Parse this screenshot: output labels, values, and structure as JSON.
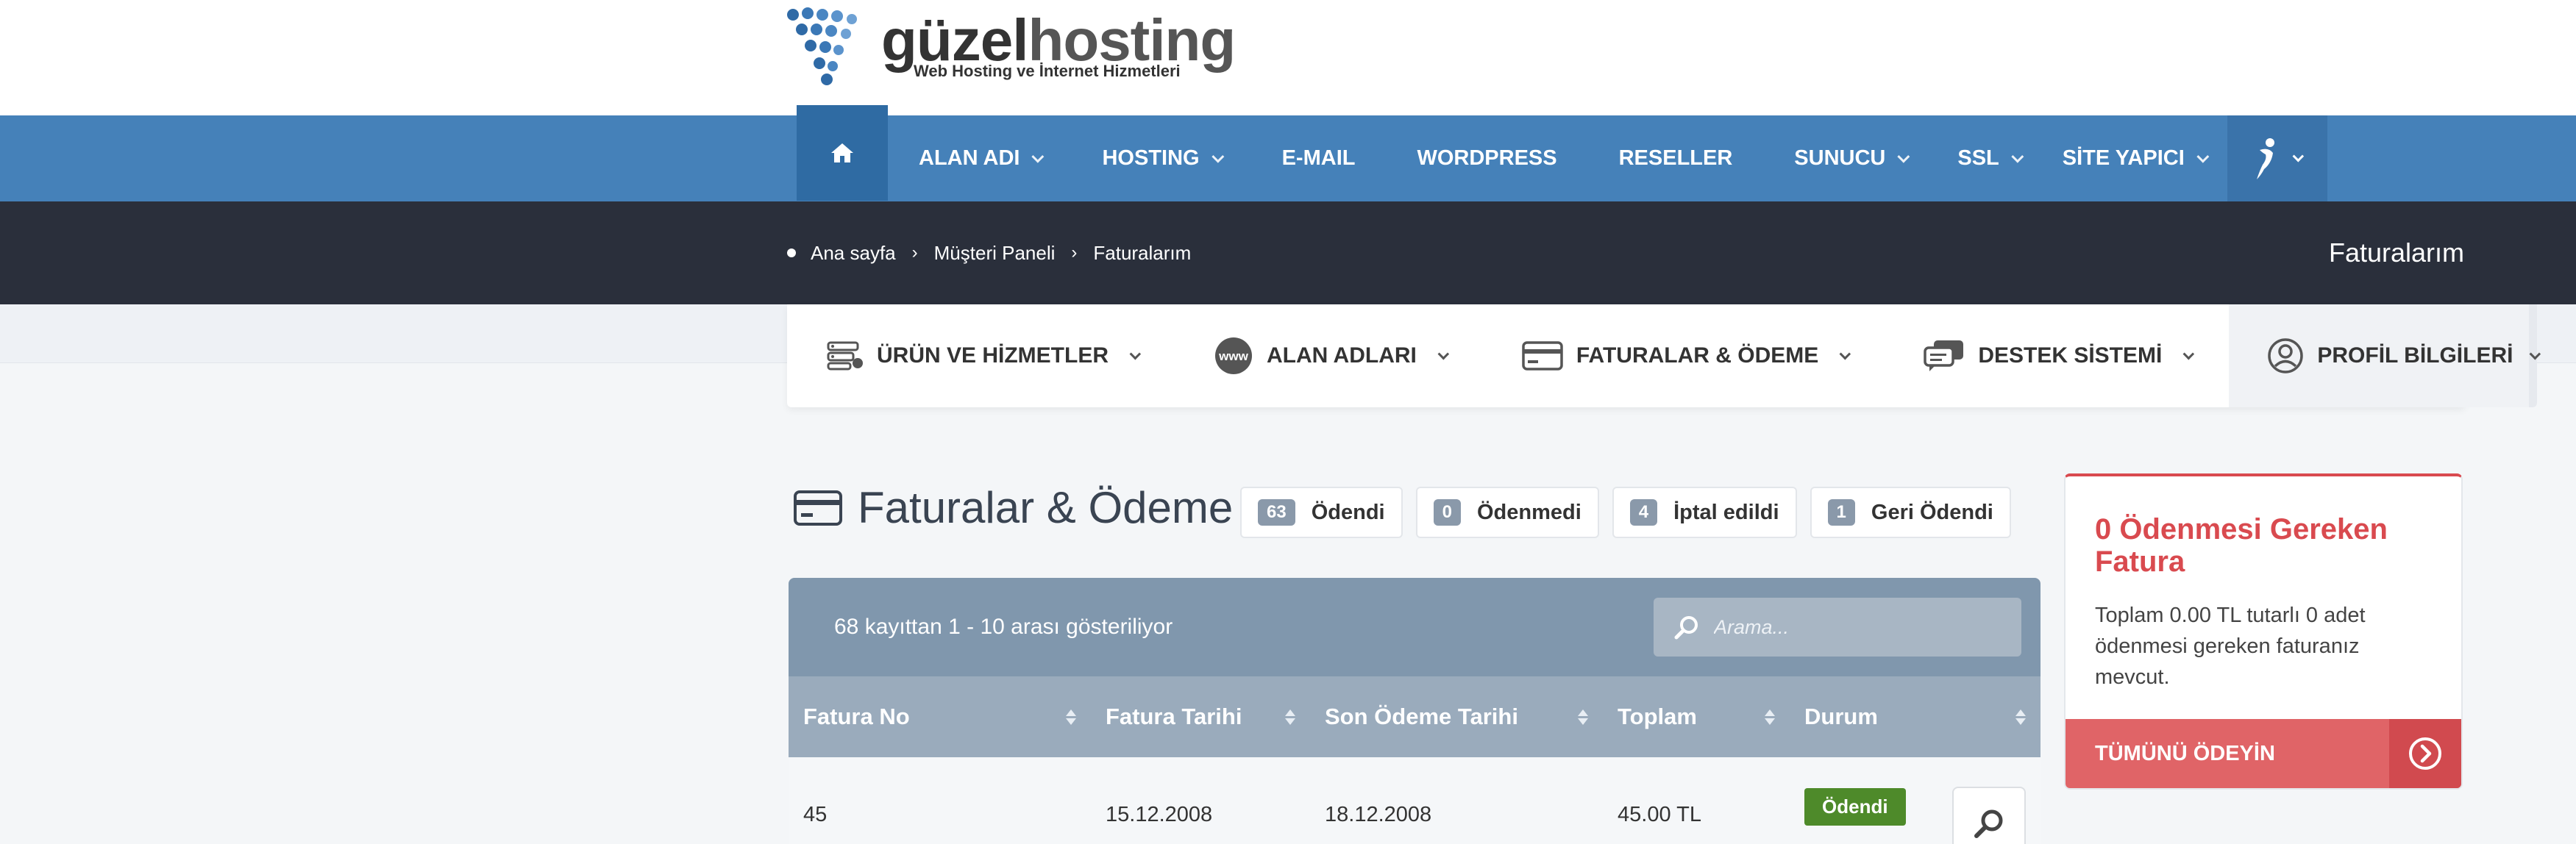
{
  "logo": {
    "name_bold": "güzel",
    "name_light": "hosting",
    "subtitle": "Web Hosting ve İnternet Hizmetleri"
  },
  "nav": {
    "items": [
      {
        "label": "ALAN ADI",
        "dropdown": true
      },
      {
        "label": "HOSTING",
        "dropdown": true
      },
      {
        "label": "E-MAIL",
        "dropdown": false
      },
      {
        "label": "WORDPRESS",
        "dropdown": false
      },
      {
        "label": "RESELLER",
        "dropdown": false
      },
      {
        "label": "SUNUCU",
        "dropdown": true
      },
      {
        "label": "SSL",
        "dropdown": true
      },
      {
        "label": "SİTE YAPICI",
        "dropdown": true
      }
    ]
  },
  "breadcrumb": {
    "items": [
      "Ana sayfa",
      "Müşteri Paneli",
      "Faturalarım"
    ],
    "page_title": "Faturalarım"
  },
  "subnav": {
    "items": [
      {
        "label": "ÜRÜN VE HİZMETLER",
        "icon": "server-icon"
      },
      {
        "label": "ALAN ADLARI",
        "icon": "www-icon"
      },
      {
        "label": "FATURALAR & ÖDEME",
        "icon": "credit-card-icon"
      },
      {
        "label": "DESTEK SİSTEMİ",
        "icon": "chat-icon"
      }
    ],
    "profile_label": "PROFİL BİLGİLERİ"
  },
  "page": {
    "title": "Faturalar & Ödeme"
  },
  "filters": [
    {
      "count": "63",
      "label": "Ödendi"
    },
    {
      "count": "0",
      "label": "Ödenmedi"
    },
    {
      "count": "4",
      "label": "İptal edildi"
    },
    {
      "count": "1",
      "label": "Geri Ödendi"
    }
  ],
  "table": {
    "records_info": "68 kayıttan 1 - 10 arası gösteriliyor",
    "search_placeholder": "Arama...",
    "columns": [
      "Fatura No",
      "Fatura Tarihi",
      "Son Ödeme Tarihi",
      "Toplam",
      "Durum"
    ],
    "rows": [
      {
        "no": "45",
        "date": "15.12.2008",
        "due": "18.12.2008",
        "total": "45.00 TL",
        "status": "Ödendi"
      }
    ]
  },
  "unpaid_card": {
    "title": "0 Ödenmesi Gereken Fatura",
    "text": "Toplam 0.00 TL tutarlı 0 adet ödenmesi gereken faturanız mevcut.",
    "button_label": "TÜMÜNÜ ÖDEYİN"
  },
  "colors": {
    "nav": "#4581b9",
    "breadcrumb_bar": "#2a2f3b",
    "accent_red": "#d94a4f",
    "paid_green": "#4e8a2a"
  }
}
